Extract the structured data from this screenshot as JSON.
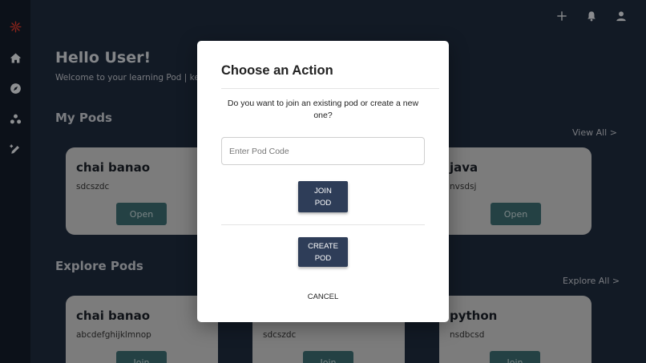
{
  "sidebar": {
    "icons": [
      "logo-icon",
      "home-icon",
      "compass-icon",
      "pods-icon",
      "edit-icon"
    ],
    "logo_color": "#e53b2c"
  },
  "topbar": {
    "icons": [
      "add-icon",
      "bell-icon",
      "user-icon"
    ]
  },
  "page": {
    "greeting": "Hello User!",
    "welcome": "Welcome to your learning Pod | kee",
    "my_pods_title": "My Pods",
    "view_all": "View All >",
    "explore_title": "Explore Pods",
    "explore_all": "Explore All >"
  },
  "my_pods": [
    {
      "title": "chai banao",
      "desc": "sdcszdc",
      "button": "Open"
    },
    {
      "title": "java",
      "desc": "nvsdsj",
      "button": "Open"
    }
  ],
  "explore_pods": [
    {
      "title": "chai banao",
      "desc": "abcdefghijklmnop",
      "button": "Join"
    },
    {
      "title": "",
      "desc": "sdcszdc",
      "button": "Join"
    },
    {
      "title": "python",
      "desc": "nsdbcsd",
      "button": "Join"
    }
  ],
  "modal": {
    "title": "Choose an Action",
    "question": "Do you want to join an existing pod or create a new one?",
    "input_placeholder": "Enter Pod Code",
    "input_value": "",
    "join_label_1": "JOIN",
    "join_label_2": "POD",
    "create_label_1": "CREATE",
    "create_label_2": "POD",
    "cancel_label": "CANCEL"
  },
  "colors": {
    "background": "#1e2a3d",
    "sidebar": "#141c29",
    "card": "#c9c9c9",
    "card_button": "#3a6a6e",
    "modal_button": "#2e3d58"
  }
}
